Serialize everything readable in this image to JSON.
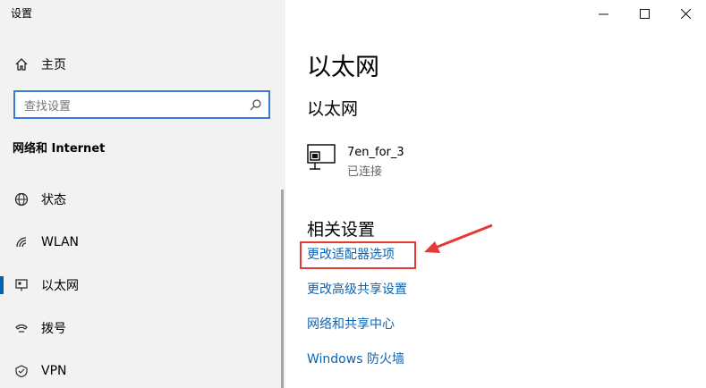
{
  "window": {
    "title": "设置"
  },
  "sidebar": {
    "home_label": "主页",
    "search_placeholder": "查找设置",
    "category": "网络和 Internet",
    "items": [
      {
        "label": "状态",
        "icon": "globe-icon"
      },
      {
        "label": "WLAN",
        "icon": "wifi-icon"
      },
      {
        "label": "以太网",
        "icon": "ethernet-icon",
        "active": true
      },
      {
        "label": "拨号",
        "icon": "dialup-icon"
      },
      {
        "label": "VPN",
        "icon": "vpn-icon"
      }
    ]
  },
  "main": {
    "page_title": "以太网",
    "section_title": "以太网",
    "network": {
      "name": "7en_for_3",
      "status": "已连接"
    },
    "related_title": "相关设置",
    "links": [
      "更改适配器选项",
      "更改高级共享设置",
      "网络和共享中心",
      "Windows 防火墙"
    ]
  },
  "colors": {
    "accent": "#0063b1",
    "link": "#0a64b4",
    "annotation": "#e53935"
  }
}
